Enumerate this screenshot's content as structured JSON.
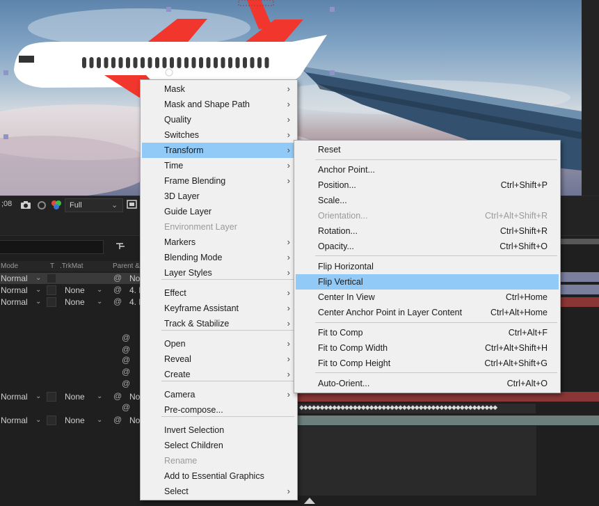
{
  "viewer": {
    "timecode_fragment": ";08",
    "resolution": "Full"
  },
  "timeline": {
    "headers": {
      "mode": "Mode",
      "t": "T",
      "trkmat": ".TrkMat",
      "parent": "Parent & L"
    },
    "rows": [
      {
        "mode": "Normal",
        "trkmat": "",
        "parent": "No"
      },
      {
        "mode": "Normal",
        "trkmat": "None",
        "parent": "4. N"
      },
      {
        "mode": "Normal",
        "trkmat": "None",
        "parent": "4. N"
      },
      {
        "mode": "Normal",
        "trkmat": "None",
        "parent": "No"
      },
      {
        "mode": "Normal",
        "trkmat": "None",
        "parent": "No"
      }
    ]
  },
  "context_menu": {
    "items": [
      {
        "label": "Mask",
        "submenu": true
      },
      {
        "label": "Mask and Shape Path",
        "submenu": true
      },
      {
        "label": "Quality",
        "submenu": true
      },
      {
        "label": "Switches",
        "submenu": true
      },
      {
        "label": "Transform",
        "submenu": true,
        "highlighted": true
      },
      {
        "label": "Time",
        "submenu": true
      },
      {
        "label": "Frame Blending",
        "submenu": true
      },
      {
        "label": "3D Layer"
      },
      {
        "label": "Guide Layer"
      },
      {
        "label": "Environment Layer",
        "disabled": true
      },
      {
        "label": "Markers",
        "submenu": true
      },
      {
        "label": "Blending Mode",
        "submenu": true
      },
      {
        "label": "Layer Styles",
        "submenu": true
      },
      {
        "label": "Effect",
        "submenu": true
      },
      {
        "label": "Keyframe Assistant",
        "submenu": true
      },
      {
        "label": "Track & Stabilize",
        "submenu": true
      },
      {
        "label": "Open",
        "submenu": true
      },
      {
        "label": "Reveal",
        "submenu": true
      },
      {
        "label": "Create",
        "submenu": true
      },
      {
        "label": "Camera",
        "submenu": true
      },
      {
        "label": "Pre-compose..."
      },
      {
        "label": "Invert Selection"
      },
      {
        "label": "Select Children"
      },
      {
        "label": "Rename",
        "disabled": true
      },
      {
        "label": "Add to Essential Graphics"
      },
      {
        "label": "Select",
        "submenu": true
      }
    ]
  },
  "transform_submenu": {
    "items": [
      {
        "label": "Reset",
        "shortcut": ""
      },
      {
        "label": "Anchor Point...",
        "shortcut": ""
      },
      {
        "label": "Position...",
        "shortcut": "Ctrl+Shift+P"
      },
      {
        "label": "Scale...",
        "shortcut": ""
      },
      {
        "label": "Orientation...",
        "shortcut": "Ctrl+Alt+Shift+R",
        "disabled": true
      },
      {
        "label": "Rotation...",
        "shortcut": "Ctrl+Shift+R"
      },
      {
        "label": "Opacity...",
        "shortcut": "Ctrl+Shift+O"
      },
      {
        "label": "Flip Horizontal",
        "shortcut": ""
      },
      {
        "label": "Flip Vertical",
        "shortcut": "",
        "highlighted": true
      },
      {
        "label": "Center In View",
        "shortcut": "Ctrl+Home"
      },
      {
        "label": "Center Anchor Point in Layer Content",
        "shortcut": "Ctrl+Alt+Home"
      },
      {
        "label": "Fit to Comp",
        "shortcut": "Ctrl+Alt+F"
      },
      {
        "label": "Fit to Comp Width",
        "shortcut": "Ctrl+Alt+Shift+H"
      },
      {
        "label": "Fit to Comp Height",
        "shortcut": "Ctrl+Alt+Shift+G"
      },
      {
        "label": "Auto-Orient...",
        "shortcut": "Ctrl+Alt+O"
      }
    ]
  },
  "colors": {
    "menu_bg": "#f0f0f0",
    "highlight": "#91c9f7",
    "airplane_red": "#f0362d",
    "wing_blue": "#33506f",
    "timeline_red": "#8b3636",
    "timeline_teal": "#6d7f7d"
  }
}
